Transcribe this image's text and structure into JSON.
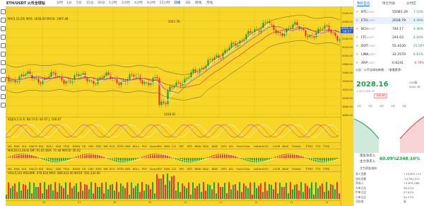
{
  "header": {
    "pair": "ETH/USDT 火币全球站",
    "timeframes": [
      "分时",
      "1分",
      "5分",
      "15分",
      "30分",
      "1小时",
      "2小时",
      "4小时",
      "6小时",
      "12小时",
      "日线",
      "3日",
      "周线",
      "月线"
    ],
    "active_timeframe": "日线"
  },
  "chart": {
    "ma_legend": "MA(5,10,20)   MA5: 2038.00   MA10: 1997.48",
    "high_label": "2041.78",
    "low_label": "1419.91",
    "kdj_legend": "KDJ(9,3,3)   K: 88.74   D: 82.67   J: 100.87",
    "macd_legend": "MACD(12,26,9)   DIF: 91.65   DEA: 71.44   MACD: 40.42",
    "volume_legend": "VOL(5,10)   VOLUME: 478,634   MA5: 489,422.00   MA10: 501,332.00",
    "indicator_bar": [
      "MA",
      "EMA",
      "VOL",
      "MACD",
      "KDJ",
      "BOLL",
      "SAR",
      "TRIX",
      "BRAR",
      "VR",
      "OBV",
      "EMV",
      "WR",
      "ROC",
      "MTM",
      "DMI",
      "BOLL",
      "PSY",
      "SomeRSI",
      "DMA",
      "CCI",
      "MFI",
      "ATR",
      "BBW",
      "SKDJ",
      "BBIE",
      "DPO",
      "ASI",
      "Fund Flow",
      "AIAlertVOL",
      "LSUR",
      "BIAS",
      "Tickets",
      "PTBO",
      "TTD",
      "TTMJ"
    ],
    "price_axis": [
      "2100.00",
      "2080.00",
      "2060.00",
      "2040.00",
      "2020.00",
      "2000.00",
      "1980.00",
      "1960.00",
      "1940.00",
      "1920.00",
      "1900.00",
      "1880.00",
      "1860.00"
    ],
    "current_price_tag": "2028.16",
    "current_price_sub": "04:57",
    "x_axis": [
      "06",
      "07",
      "08",
      "09",
      "10",
      "11",
      "12",
      "13",
      "14"
    ]
  },
  "sidebar": {
    "tabs": [
      "我的自选",
      "持仓列表",
      "分时区"
    ],
    "watchlist": [
      {
        "coin": "BTC",
        "quote": "USDT",
        "price": "55081.29",
        "change": "7.10%",
        "dir": "up"
      },
      {
        "coin": "ETH",
        "quote": "USDT",
        "price": "2028.79",
        "change": "4.49%",
        "dir": "up"
      },
      {
        "coin": "BCH",
        "quote": "USDT",
        "price": "744.17",
        "change": "4.48%",
        "dir": "up"
      },
      {
        "coin": "LTC",
        "quote": "USDT",
        "price": "244.03",
        "change": "4.18%",
        "dir": "up"
      },
      {
        "coin": "DOT",
        "quote": "USDT",
        "price": "55.4100",
        "change": "25.56%",
        "dir": "up"
      },
      {
        "coin": "LINK",
        "quote": "USDT",
        "price": "32.2570",
        "change": "6.61%",
        "dir": "up"
      },
      {
        "coin": "XRP",
        "quote": "USDT",
        "price": "0.6241",
        "change": "-0.79%",
        "dir": "down"
      }
    ],
    "notice": "公告：火币全球站新增...（查看更多）",
    "big_price": "2028.16",
    "big_price_sub": "≈ ¥13,189.30",
    "change_badge": "+95.87",
    "right_stats": "24H高 2041.78",
    "button_row": [
      "1日",
      "3日",
      "5日",
      "1月",
      "3月"
    ],
    "stat_label_left": "现货净流入",
    "stat_value_left": "60.09%",
    "stat_label_right": "主力净流入",
    "stat_value_right": "2348.10%",
    "section_label": "主力资金流向",
    "list_rows": [
      {
        "l": "流入金额",
        "r": "+19,823,117"
      },
      {
        "l": "流出金额",
        "r": "-14,992,031"
      },
      {
        "l": "净流入",
        "r": "+4,831,086"
      },
      {
        "l": "大单占比",
        "r": "38.22%"
      },
      {
        "l": "中单占比",
        "r": "27.41%"
      },
      {
        "l": "小单占比",
        "r": "34.37%"
      },
      {
        "l": "活跃度",
        "r": "高"
      }
    ]
  },
  "colors": {
    "chart_bg": "#f7d628",
    "up": "#16a34a",
    "down": "#e0363c",
    "accent": "#1a73e8"
  }
}
